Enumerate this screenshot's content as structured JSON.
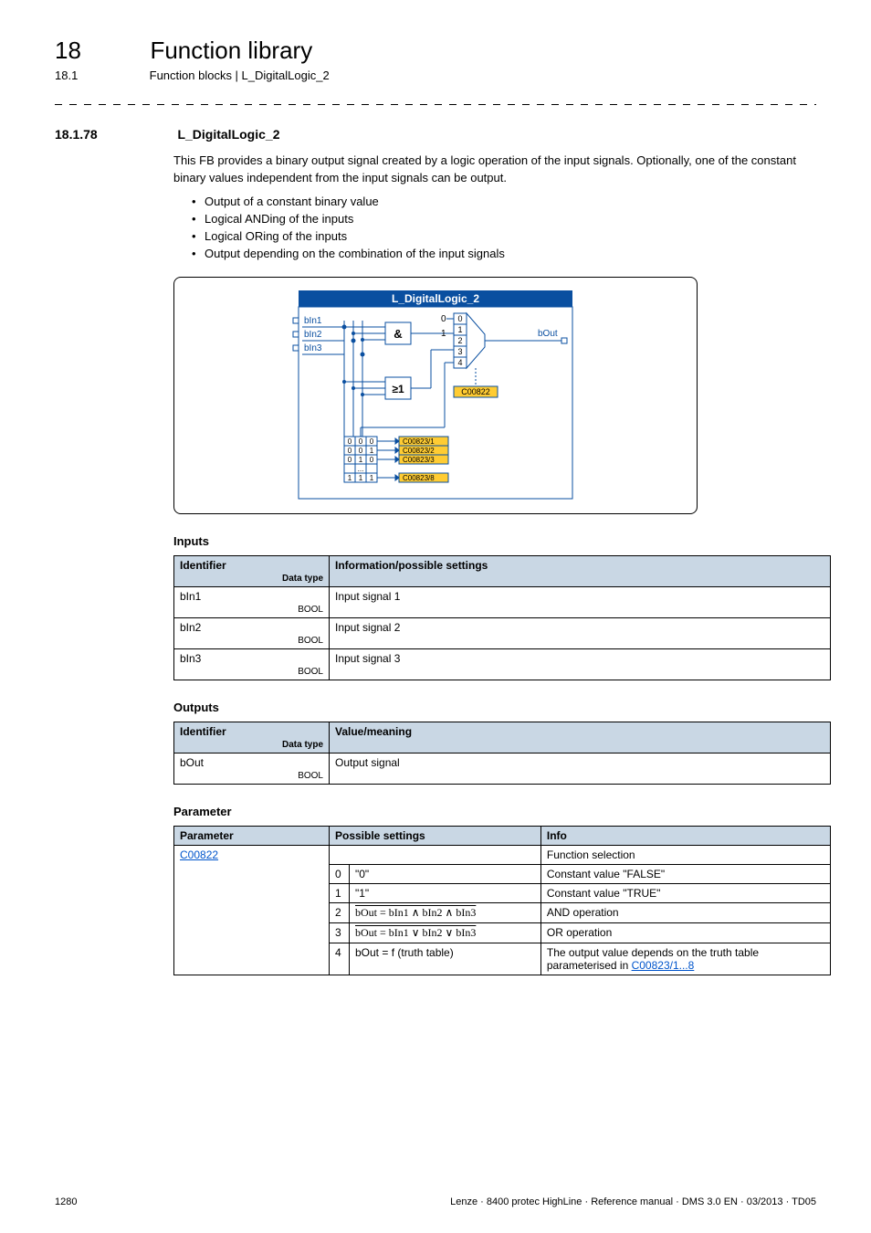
{
  "header": {
    "chapter_num": "18",
    "chapter_title": "Function library",
    "sub_num": "18.1",
    "sub_title": "Function blocks | L_DigitalLogic_2"
  },
  "section": {
    "num": "18.1.78",
    "title": "L_DigitalLogic_2",
    "intro": "This FB provides a binary output signal created by a logic operation of the input signals. Optionally, one of the constant binary values independent from the input signals can be output.",
    "bullets": [
      "Output of a constant binary value",
      "Logical ANDing of the inputs",
      "Logical ORing of the inputs",
      "Output depending on the combination of the input signals"
    ]
  },
  "diagram": {
    "title": "L_DigitalLogic_2",
    "in1": "bIn1",
    "in2": "bIn2",
    "in3": "bIn3",
    "out": "bOut",
    "and": "&",
    "or": "≥1",
    "mux0": "0",
    "mux1": "1",
    "mux2": "2",
    "mux3": "3",
    "mux4": "4",
    "code_main": "C00822",
    "code1": "C00823/1",
    "code2": "C00823/2",
    "code3": "C00823/3",
    "code8": "C00823/8",
    "const0": "0",
    "const1": "1"
  },
  "inputs": {
    "heading": "Inputs",
    "col_id": "Identifier",
    "col_dt": "Data type",
    "col_info": "Information/possible settings",
    "rows": [
      {
        "id": "bIn1",
        "dt": "BOOL",
        "info": "Input signal 1"
      },
      {
        "id": "bIn2",
        "dt": "BOOL",
        "info": "Input signal 2"
      },
      {
        "id": "bIn3",
        "dt": "BOOL",
        "info": "Input signal 3"
      }
    ]
  },
  "outputs": {
    "heading": "Outputs",
    "col_id": "Identifier",
    "col_dt": "Data type",
    "col_info": "Value/meaning",
    "rows": [
      {
        "id": "bOut",
        "dt": "BOOL",
        "info": "Output signal"
      }
    ]
  },
  "params": {
    "heading": "Parameter",
    "col_p": "Parameter",
    "col_s": "Possible settings",
    "col_i": "Info",
    "code": "C00822",
    "info_top": "Function selection",
    "rows": [
      {
        "n": "0",
        "s": "\"0\"",
        "i": "Constant value \"FALSE\""
      },
      {
        "n": "1",
        "s": "\"1\"",
        "i": "Constant value \"TRUE\""
      },
      {
        "n": "2",
        "s": "bOut = bIn1 ∧ bIn2 ∧ bIn3",
        "i": "AND operation"
      },
      {
        "n": "3",
        "s": "bOut = bIn1 ∨ bIn2 ∨ bIn3",
        "i": "OR operation"
      },
      {
        "n": "4",
        "s": "bOut = f (truth table)",
        "i_prefix": "The output value depends on the truth table parameterised in ",
        "i_link": "C00823/1...8"
      }
    ]
  },
  "footer": {
    "page": "1280",
    "meta": "Lenze · 8400 protec HighLine · Reference manual · DMS 3.0 EN · 03/2013 · TD05"
  }
}
